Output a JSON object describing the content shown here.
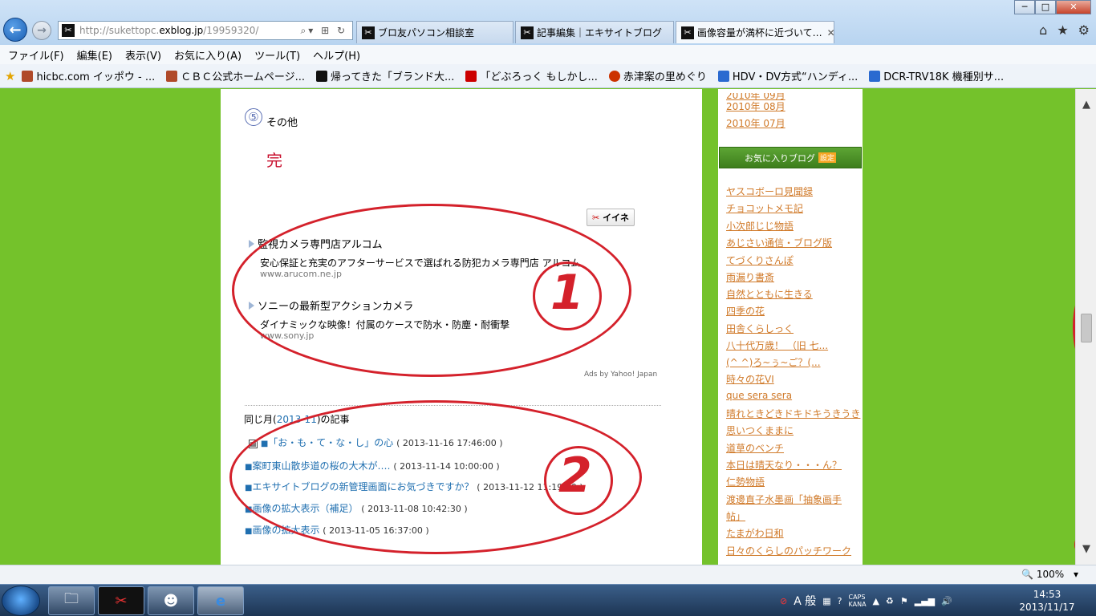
{
  "browser": {
    "url_prefix": "http://sukettopc.",
    "url_host": "exblog.jp",
    "url_path": "/19959320/",
    "tabs": [
      {
        "label": "ブロ友パソコン相談室"
      },
      {
        "label": "記事編集｜エキサイトブログ"
      },
      {
        "label": "画像容量が満杯に近づいて…"
      }
    ],
    "menu": [
      "ファイル(F)",
      "編集(E)",
      "表示(V)",
      "お気に入り(A)",
      "ツール(T)",
      "ヘルプ(H)"
    ],
    "favorites": [
      {
        "label": "hicbc.com イッポウ - ...",
        "color": "#b04a2a"
      },
      {
        "label": "ＣＢＣ公式ホームページ...",
        "color": "#b04a2a"
      },
      {
        "label": "帰ってきた「ブランド大...",
        "color": "#111111"
      },
      {
        "label": "「どぶろっく もしかし...",
        "color": "#cc0000"
      },
      {
        "label": "赤津案の里めぐり",
        "color": "#cc3300"
      },
      {
        "label": "HDV・DV方式“ハンディ...",
        "color": "#2a6ad0"
      },
      {
        "label": "DCR-TRV18K 機種別サ...",
        "color": "#2a6ad0"
      }
    ],
    "zoom": "100%"
  },
  "article": {
    "section_num": "⑤",
    "section_label": "その他",
    "end_mark": "完",
    "like_label": "イイネ",
    "ads": [
      {
        "title": "監視カメラ専門店アルコム",
        "desc": "安心保証と充実のアフターサービスで選ばれる防犯カメラ専門店 アルコム",
        "url": "www.arucom.ne.jp"
      },
      {
        "title": "ソニーの最新型アクションカメラ",
        "desc": "ダイナミックな映像！付属のケースで防水・防塵・耐衝撃",
        "url": "www.sony.jp"
      }
    ],
    "ads_credit": "Ads by Yahoo! Japan",
    "same_month_prefix": "同じ月(",
    "same_month_link": "2013-11",
    "same_month_suffix": ")の記事",
    "posts": [
      {
        "title": "「お・も・て・な・し」の心",
        "date": "( 2013-11-16 17:46:00 )"
      },
      {
        "title": "案町東山散歩道の桜の大木が‥‥",
        "date": "( 2013-11-14 10:00:00 )"
      },
      {
        "title": "エキサイトブログの新管理画面にお気づきですか？",
        "date": "( 2013-11-12 11:19:00 )"
      },
      {
        "title": "画像の拡大表示（補足）",
        "date": "( 2013-11-08 10:42:30 )"
      },
      {
        "title": "画像の拡大表示",
        "date": "( 2013-11-05 16:37:00 )"
      }
    ],
    "annotation_1": "1",
    "annotation_2": "2"
  },
  "sidebar": {
    "archives": [
      "2010年 09月",
      "2010年 08月",
      "2010年 07月"
    ],
    "favorites_header": "お気に入りブログ",
    "favorites_setting": "設定",
    "blogs": [
      "ヤスコボーロ見聞録",
      "チョコットメモ記",
      "小次郎じじ物語",
      "あじさい通信・ブログ版",
      "てづくりさんぽ",
      "雨漏り書斎",
      "自然とともに生きる",
      "四季の花",
      "田舎くらしっく",
      "八十代万歳！ （旧 七...",
      "(^ ^)ろ~ぅ~ご？(...",
      "時々の花VI",
      "que sera sera",
      "晴れときどきドキドキうきうき",
      "思いつくままに",
      "道草のベンチ",
      "本日は晴天なり・・・ん？",
      "仁勢物語",
      "渡邊直子水墨画「抽象画手",
      "帖」",
      "たまがわ日和",
      "日々のくらしのパッチワーク"
    ]
  },
  "taskbar": {
    "time": "14:53",
    "date": "2013/11/17",
    "ime": "A 般"
  },
  "colors": {
    "page_bg": "#74c22b",
    "link": "#1f6fb0",
    "side_link": "#d07a2a",
    "annotation": "#d4212b"
  }
}
